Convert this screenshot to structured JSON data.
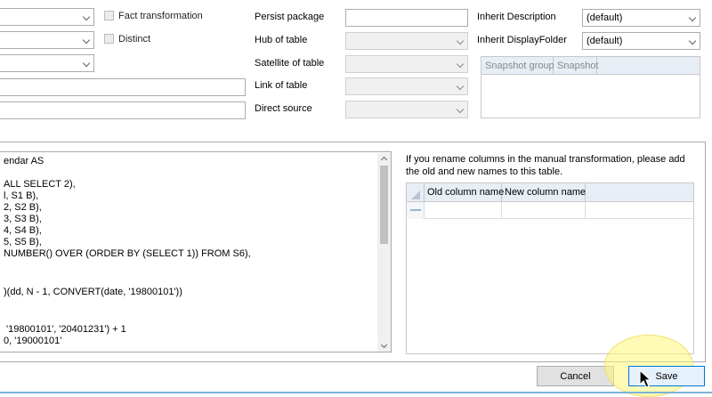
{
  "options": {
    "fact_transformation": "Fact transformation",
    "distinct": "Distinct"
  },
  "middle": {
    "persist_package": "Persist package",
    "hub_of_table": "Hub of table",
    "satellite_of_table": "Satellite of table",
    "link_of_table": "Link of table",
    "direct_source": "Direct source"
  },
  "right": {
    "inherit_description": "Inherit Description",
    "inherit_description_value": "(default)",
    "inherit_displayfolder": "Inherit DisplayFolder",
    "inherit_displayfolder_value": "(default)",
    "snapshot_grid": {
      "columns": [
        "Snapshot group",
        "Snapshot"
      ]
    }
  },
  "editor": {
    "lines": [
      "endar AS",
      "",
      "ALL SELECT 2),",
      "l, S1 B),",
      "2, S2 B),",
      "3, S3 B),",
      "4, S4 B),",
      "5, S5 B),",
      "NUMBER() OVER (ORDER BY (SELECT 1)) FROM S6),",
      "",
      "",
      ")(dd, N - 1, CONVERT(date, '19800101'))",
      "",
      "",
      " '19800101', '20401231') + 1",
      "0, '19000101'"
    ]
  },
  "rename": {
    "info": "If you rename columns in the manual transformation, please add the old and new names to this table.",
    "columns": [
      "Old column name",
      "New column name"
    ]
  },
  "buttons": {
    "cancel": "Cancel",
    "save": "Save"
  }
}
